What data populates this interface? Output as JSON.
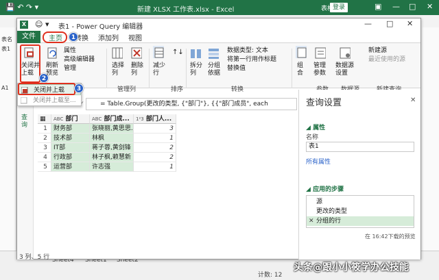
{
  "excel": {
    "title": "新建 XLSX 工作表.xlsx  -  Excel",
    "table_tools": "表格工具",
    "login": "登录",
    "name_box": "表1",
    "cell_ref": "A1",
    "left_labels": [
      "表名",
      "表1"
    ],
    "sheet_tabs": [
      "Sheet4",
      "Sheet1",
      "Sheet2"
    ],
    "status_bar": "计数: 12"
  },
  "pq": {
    "title": "表1 - Power Query 编辑器",
    "tabs": {
      "file": "文件",
      "home": "主页",
      "transform": "转换",
      "add_column": "添加列",
      "view": "视图"
    },
    "ribbon": {
      "close_load": "关闭并\n上载",
      "refresh": "刷新\n预览",
      "properties": "属性",
      "advanced_editor": "高级编辑器",
      "manage": "管理",
      "choose_cols": "选择\n列",
      "remove_cols": "删除\n列",
      "reduce_rows": "减少\n行",
      "split_col": "拆分\n列",
      "group_by": "分组\n依据",
      "data_type": "数据类型: 文本",
      "first_row_header": "将第一行用作标题",
      "replace_values": "替换值",
      "combine": "组\n合",
      "manage_params": "管理\n参数",
      "data_source_settings": "数据源\n设置",
      "new_source": "新建源",
      "recent_sources": "最近使用的源",
      "group_manage_cols": "管理列",
      "group_sort": "排序",
      "group_transform": "转换",
      "group_params": "参数",
      "group_datasource": "数据源",
      "group_new_query": "新建查询"
    },
    "dropdown": {
      "item1": "关闭并上载",
      "item2": "关闭并上载至..."
    },
    "badges": [
      "1",
      "2",
      "3"
    ],
    "formula": "= Table.Group(更改的类型, {\"部门\"}, {{\"部门成员\", each",
    "nav_label": "查询",
    "table": {
      "headers": [
        "部门",
        "部门成...",
        "部门人..."
      ],
      "header_types": [
        "ABC",
        "ABC",
        "1²3"
      ],
      "rows": [
        {
          "n": "1",
          "dept": "财务部",
          "members": "张晓丽,黄思思...",
          "count": "3"
        },
        {
          "n": "2",
          "dept": "技术部",
          "members": "林枫",
          "count": "1"
        },
        {
          "n": "3",
          "dept": "IT部",
          "members": "蒋子蓉,黄剑锋",
          "count": "2"
        },
        {
          "n": "4",
          "dept": "行政部",
          "members": "林子枫,赖慧新",
          "count": "2"
        },
        {
          "n": "5",
          "dept": "运营部",
          "members": "许志强",
          "count": "1"
        }
      ]
    },
    "settings": {
      "title": "查询设置",
      "properties": "属性",
      "name_label": "名称",
      "name_value": "表1",
      "all_properties": "所有属性",
      "applied_steps": "应用的步骤",
      "steps": [
        "源",
        "更改的类型",
        "分组的行"
      ]
    },
    "status_left": "3 列、5 行",
    "status_right": "在 16:42下载的预览"
  },
  "watermark": "头条@跟小小筱学办公技能",
  "colors": {
    "excel_green": "#217346",
    "highlight_red": "#e0301e",
    "badge_blue": "#2a62c9",
    "step_selected": "#d6ecd9"
  }
}
